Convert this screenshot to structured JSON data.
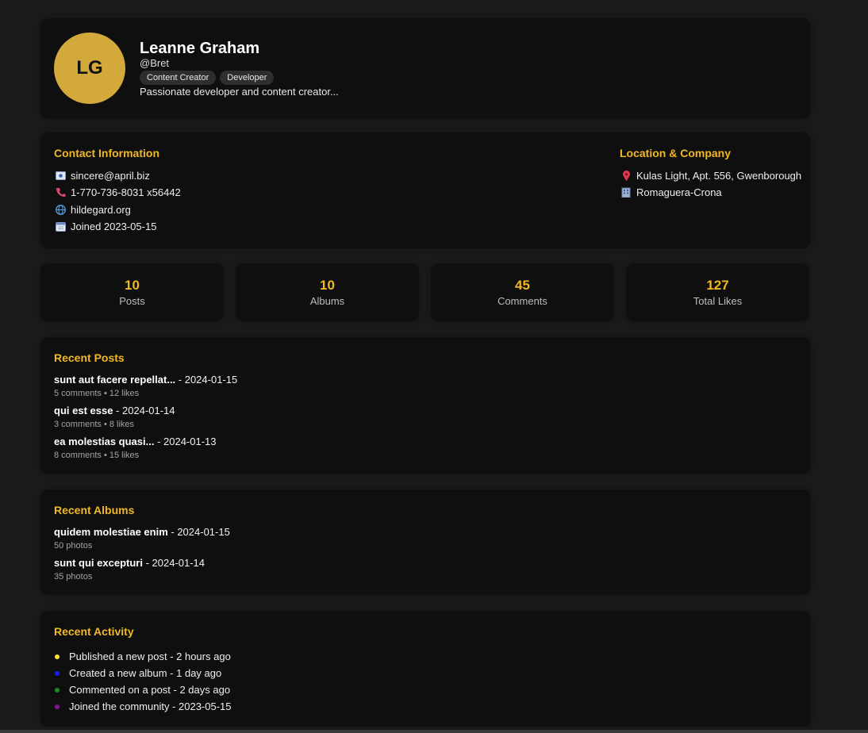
{
  "profile": {
    "initials": "LG",
    "avatar_color": "#d4a93b",
    "name": "Leanne Graham",
    "handle": "@Bret",
    "tags": [
      "Content Creator",
      "Developer"
    ],
    "bio": "Passionate developer and content creator..."
  },
  "contact": {
    "title": "Contact Information",
    "items": [
      {
        "icon": "email-icon",
        "text": "sincere@april.biz"
      },
      {
        "icon": "phone-icon",
        "text": "1-770-736-8031 x56442"
      },
      {
        "icon": "globe-icon",
        "text": "hildegard.org"
      },
      {
        "icon": "calendar-icon",
        "text": "Joined 2023-05-15"
      }
    ]
  },
  "location": {
    "title": "Location & Company",
    "items": [
      {
        "icon": "pin-icon",
        "text": "Kulas Light, Apt. 556, Gwenborough"
      },
      {
        "icon": "building-icon",
        "text": "Romaguera-Crona"
      }
    ]
  },
  "stats": [
    {
      "value": "10",
      "label": "Posts"
    },
    {
      "value": "10",
      "label": "Albums"
    },
    {
      "value": "45",
      "label": "Comments"
    },
    {
      "value": "127",
      "label": "Total Likes"
    }
  ],
  "posts": {
    "title": "Recent Posts",
    "items": [
      {
        "title": "sunt aut facere repellat...",
        "date": " - 2024-01-15",
        "meta": "5 comments • 12 likes"
      },
      {
        "title": "qui est esse",
        "date": " - 2024-01-14",
        "meta": "3 comments • 8 likes"
      },
      {
        "title": "ea molestias quasi...",
        "date": " - 2024-01-13",
        "meta": "8 comments • 15 likes"
      }
    ]
  },
  "albums": {
    "title": "Recent Albums",
    "items": [
      {
        "title": "quidem molestiae enim",
        "date": " - 2024-01-15",
        "meta": "50 photos"
      },
      {
        "title": "sunt qui excepturi",
        "date": " - 2024-01-14",
        "meta": "35 photos"
      }
    ]
  },
  "activity": {
    "title": "Recent Activity",
    "items": [
      {
        "text": "Published a new post - 2 hours ago",
        "color": "#ffe135"
      },
      {
        "text": "Created a new album - 1 day ago",
        "color": "#1a1aff"
      },
      {
        "text": "Commented on a post - 2 days ago",
        "color": "#1e8a1e"
      },
      {
        "text": "Joined the community - 2023-05-15",
        "color": "#7a1a8a"
      }
    ]
  },
  "colors": {
    "accent": "#f2b824",
    "card": "#0f0f0f",
    "background": "#1b1b1b"
  }
}
